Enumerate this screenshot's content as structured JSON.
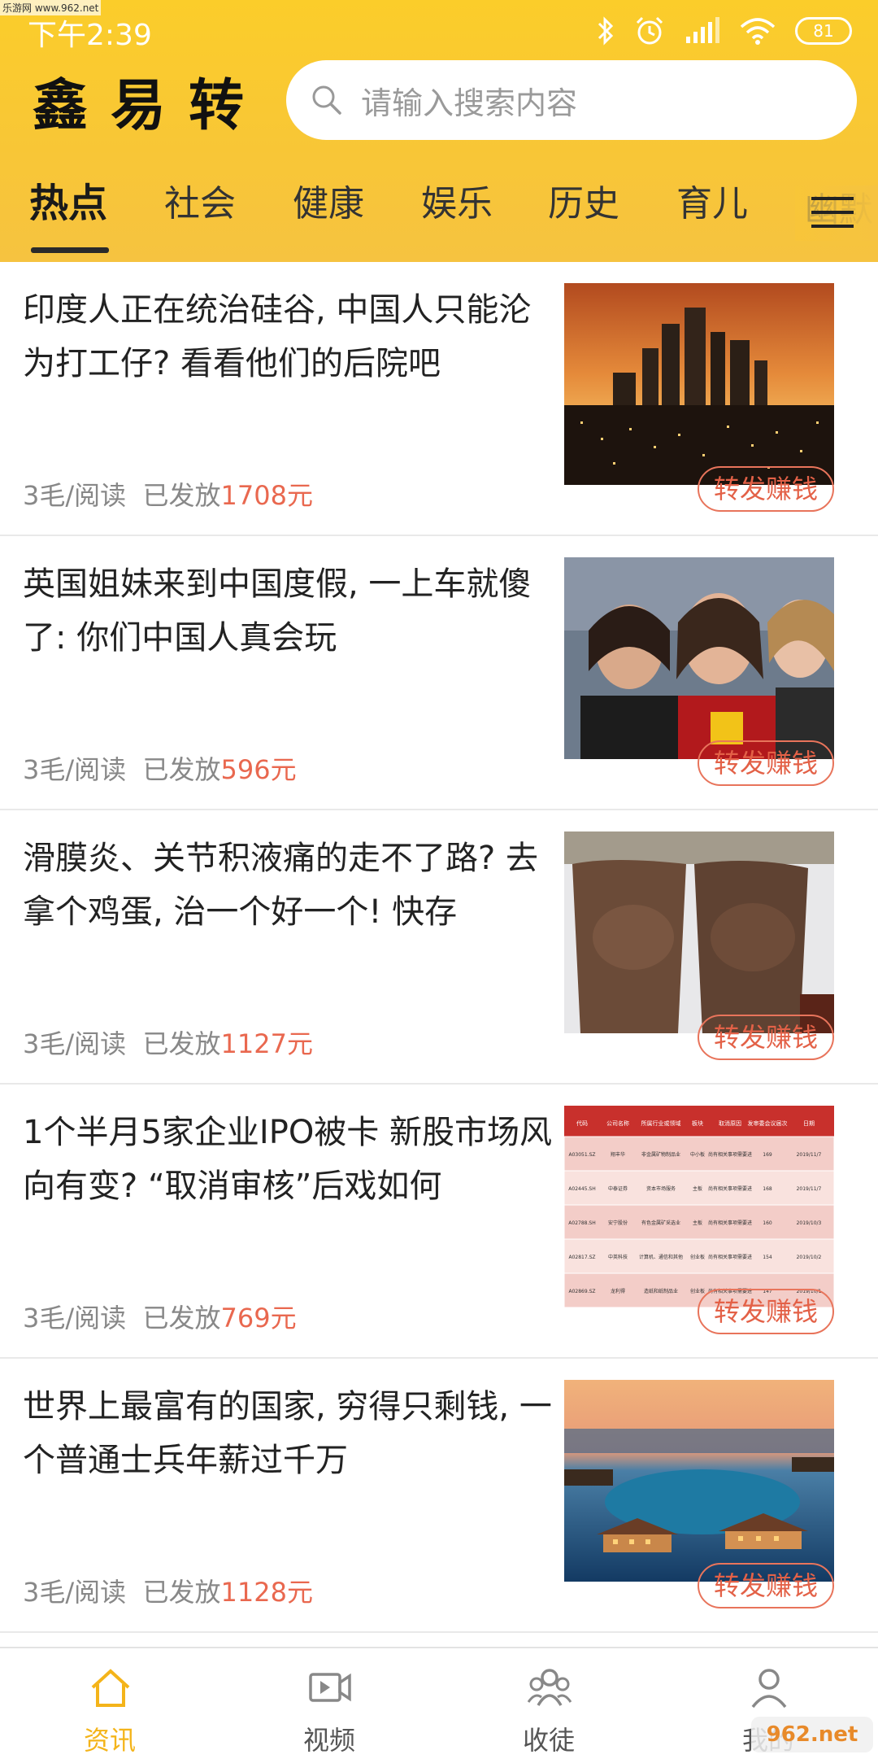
{
  "watermark": "乐游网 www.962.net",
  "status": {
    "time": "下午2:39",
    "battery": "81"
  },
  "header": {
    "logo_chars": [
      "鑫",
      "易",
      "转"
    ],
    "search_placeholder": "请输入搜索内容"
  },
  "tabs": [
    {
      "label": "热点",
      "active": true
    },
    {
      "label": "社会"
    },
    {
      "label": "健康"
    },
    {
      "label": "娱乐"
    },
    {
      "label": "历史"
    },
    {
      "label": "育儿"
    },
    {
      "label": "幽默"
    }
  ],
  "articles": [
    {
      "title": "印度人正在统治硅谷, 中国人只能沦为打工仔? 看看他们的后院吧",
      "rate": "3毛/阅读",
      "paid_prefix": "已发放",
      "paid_amount": "1708元",
      "share": "转发赚钱"
    },
    {
      "title": "英国姐妹来到中国度假, 一上车就傻了: 你们中国人真会玩",
      "rate": "3毛/阅读",
      "paid_prefix": "已发放",
      "paid_amount": "596元",
      "share": "转发赚钱"
    },
    {
      "title": "滑膜炎、关节积液痛的走不了路? 去拿个鸡蛋, 治一个好一个! 快存",
      "rate": "3毛/阅读",
      "paid_prefix": "已发放",
      "paid_amount": "1127元",
      "share": "转发赚钱"
    },
    {
      "title": "1个半月5家企业IPO被卡 新股市场风向有变? “取消审核”后戏如何",
      "rate": "3毛/阅读",
      "paid_prefix": "已发放",
      "paid_amount": "769元",
      "share": "转发赚钱"
    },
    {
      "title": "世界上最富有的国家, 穷得只剩钱, 一个普通士兵年薪过千万",
      "rate": "3毛/阅读",
      "paid_prefix": "已发放",
      "paid_amount": "1128元",
      "share": "转发赚钱"
    }
  ],
  "ipo_table": {
    "headers": [
      "代码",
      "公司名称",
      "所属行业或领域",
      "板块",
      "取消原因",
      "发审委会议届次",
      "日期"
    ],
    "rows": [
      [
        "A03051.SZ",
        "翔丰华",
        "非金属矿物制品业",
        "中小板",
        "尚有相关事项需要进一步核查",
        "169",
        "2019/11/7"
      ],
      [
        "A02445.SH",
        "中泰证券",
        "资本市场服务",
        "主板",
        "尚有相关事项需要进一步核查",
        "168",
        "2019/11/7"
      ],
      [
        "A02788.SH",
        "安宁股份",
        "有色金属矿采选业",
        "主板",
        "尚有相关事项需要进一步核查",
        "160",
        "2019/10/31"
      ],
      [
        "A02817.SZ",
        "中英科技",
        "计算机、通信和其他电子设备制造业",
        "创业板",
        "尚有相关事项需要进一步核查",
        "154",
        "2019/10/24"
      ],
      [
        "A02869.SZ",
        "龙利得",
        "造纸和纸制品业",
        "创业板",
        "尚有相关事项需要进一步核查",
        "147",
        "2019/10/17"
      ]
    ]
  },
  "bottom_nav": [
    {
      "label": "资讯",
      "active": true
    },
    {
      "label": "视频"
    },
    {
      "label": "收徒"
    },
    {
      "label": "我的"
    }
  ],
  "corner_badge": "962.net",
  "colors": {
    "accent": "#f8c637",
    "amount": "#e9684f",
    "nav_active": "#f4b41a"
  }
}
